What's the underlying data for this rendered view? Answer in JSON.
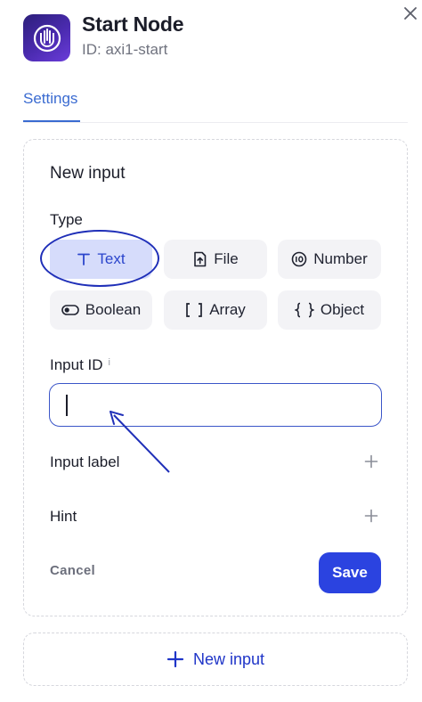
{
  "header": {
    "title": "Start Node",
    "id_text": "ID: axi1-start",
    "icon": "start-node-logo"
  },
  "tabs": [
    {
      "label": "Settings",
      "active": true
    }
  ],
  "form": {
    "heading": "New input",
    "type_label": "Type",
    "types": [
      {
        "label": "Text",
        "icon": "text-type-icon",
        "selected": true
      },
      {
        "label": "File",
        "icon": "file-upload-icon",
        "selected": false
      },
      {
        "label": "Number",
        "icon": "number-icon",
        "selected": false
      },
      {
        "label": "Boolean",
        "icon": "toggle-icon",
        "selected": false
      },
      {
        "label": "Array",
        "icon": "brackets-icon",
        "selected": false
      },
      {
        "label": "Object",
        "icon": "braces-icon",
        "selected": false
      }
    ],
    "input_id_label": "Input ID",
    "input_id_info": "i",
    "input_id_value": "",
    "input_label": "Input label",
    "hint_label": "Hint",
    "cancel_label": "Cancel",
    "save_label": "Save"
  },
  "new_input_label": "New input",
  "colors": {
    "accent": "#2b43e0",
    "tab_active": "#3a6bd1",
    "chip_selected_bg": "#d6dcfb",
    "annotation": "#1f2fb8"
  }
}
